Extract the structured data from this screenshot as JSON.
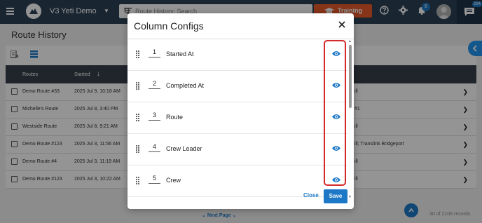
{
  "app": {
    "title": "V3 Yeti Demo"
  },
  "search": {
    "placeholder": "Route History: Search"
  },
  "header": {
    "training_label": "Training",
    "notification_count": "8",
    "chat_count": "294"
  },
  "page": {
    "title": "Route History"
  },
  "table": {
    "columns": [
      "Routes",
      "Started"
    ],
    "rows": [
      {
        "route": "Demo Route #33",
        "started": "2025 Jul 9, 10:18 AM",
        "extra": "ill"
      },
      {
        "route": "Michelle's Route",
        "started": "2025 Jul 8, 3:40 PM",
        "extra": "#1"
      },
      {
        "route": "Westside Route",
        "started": "2025 Jul 8, 9:21 AM",
        "extra": "ill"
      },
      {
        "route": "Demo Route #123",
        "started": "2025 Jul 3, 11:56 AM",
        "extra": "ill; Translink Bridgeport"
      },
      {
        "route": "Demo Route #4",
        "started": "2025 Jul 3, 11:19 AM",
        "extra": "ill"
      },
      {
        "route": "Demo Route #123",
        "started": "2025 Jul 3, 10:22 AM",
        "extra": "ill"
      }
    ]
  },
  "pagination": {
    "next_label": "Next Page",
    "records": "30 of 2106 records"
  },
  "modal": {
    "title": "Column Configs",
    "items": [
      {
        "num": "1",
        "label": "Started At"
      },
      {
        "num": "2",
        "label": "Completed At"
      },
      {
        "num": "3",
        "label": "Route"
      },
      {
        "num": "4",
        "label": "Crew Leader"
      },
      {
        "num": "5",
        "label": "Crew"
      }
    ],
    "close_label": "Close",
    "save_label": "Save"
  },
  "colors": {
    "brand": "#2b4256",
    "accent": "#1d79c7",
    "training": "#e85a2a",
    "highlight": "#d42a2a"
  }
}
